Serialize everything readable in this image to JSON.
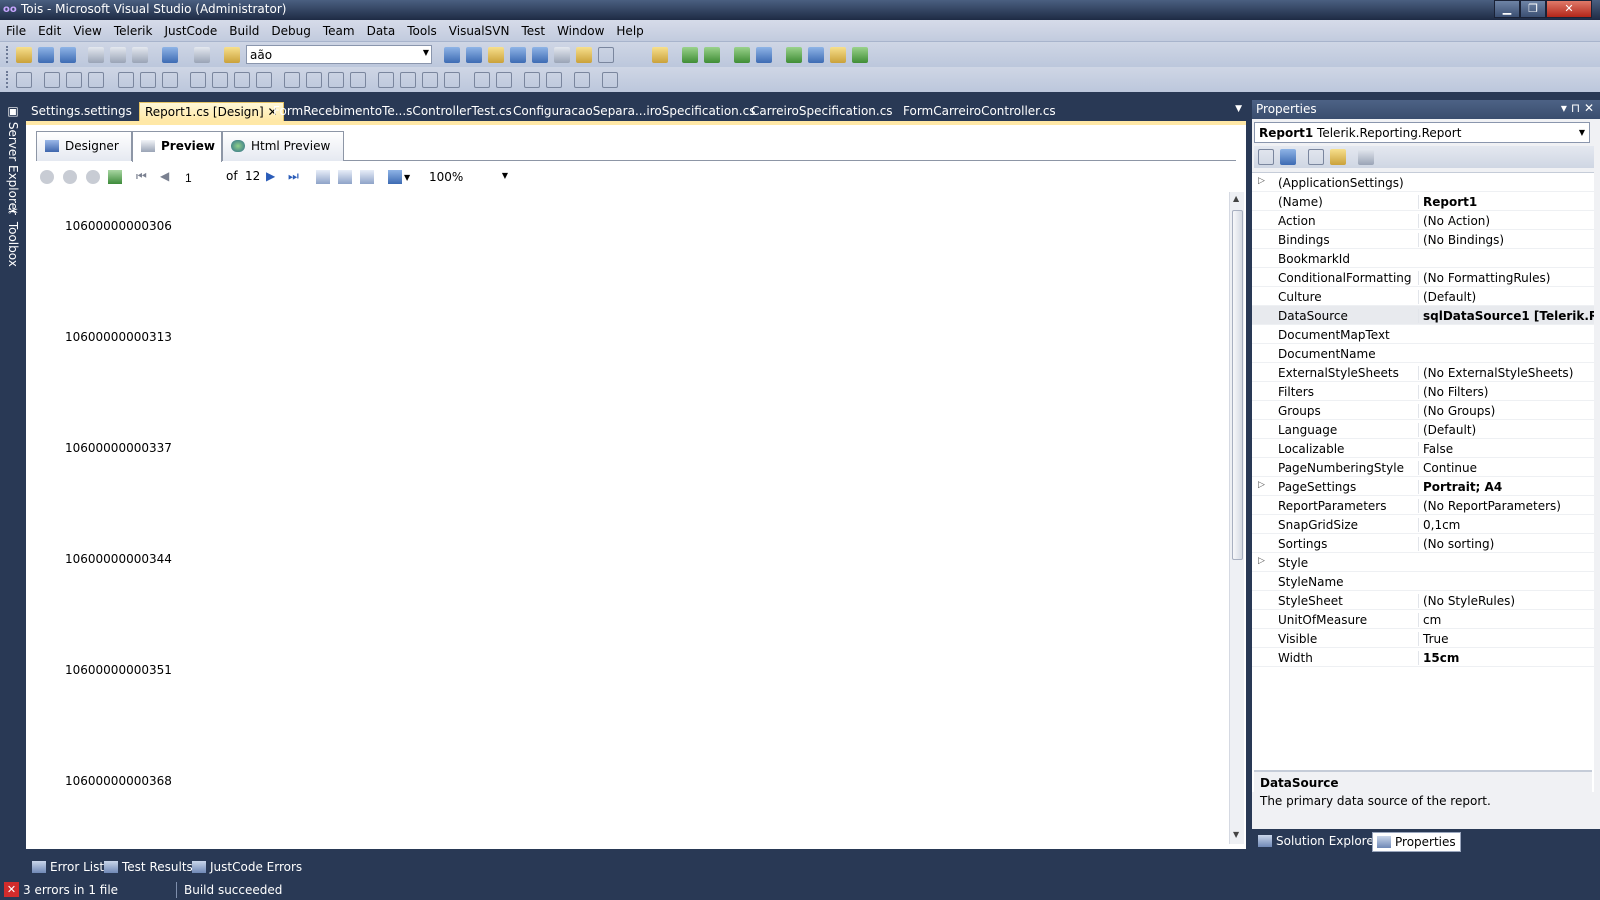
{
  "window": {
    "title": "Tois - Microsoft Visual Studio (Administrator)",
    "app_icon": "oo",
    "minimize_glyph": "▁",
    "restore_glyph": "❐",
    "close_glyph": "✕"
  },
  "menu": {
    "items": [
      "File",
      "Edit",
      "View",
      "Telerik",
      "JustCode",
      "Build",
      "Debug",
      "Team",
      "Data",
      "Tools",
      "VisualSVN",
      "Test",
      "Window",
      "Help"
    ]
  },
  "toolbar": {
    "search_value": "aão"
  },
  "left_rail": {
    "server_explorer": "Server Explorer",
    "toolbox": "Toolbox"
  },
  "doc_tabs": {
    "tabs": [
      {
        "label": "Settings.settings"
      },
      {
        "label": "Report1.cs [Design]"
      },
      {
        "label": "FormRecebimentoTe...sControllerTest.cs"
      },
      {
        "label": "ConfiguracaoSepara...iroSpecification.cs"
      },
      {
        "label": "CarreiroSpecification.cs"
      },
      {
        "label": "FormCarreiroController.cs"
      }
    ],
    "close_glyph": "✕",
    "dropdown_glyph": "▼"
  },
  "view_tabs": {
    "designer": "Designer",
    "preview": "Preview",
    "html_preview": "Html Preview"
  },
  "report_toolbar": {
    "page_value": "1",
    "of_label": "of",
    "total_pages": "12",
    "zoom": "100%"
  },
  "report_rows": [
    "10600000000306",
    "10600000000313",
    "10600000000337",
    "10600000000344",
    "10600000000351",
    "10600000000368"
  ],
  "properties": {
    "title": "Properties",
    "pin_glyphs": "▾ ⊓ ✕",
    "object_name": "Report1",
    "object_type": "Telerik.Reporting.Report",
    "rows": [
      {
        "name": "(ApplicationSettings)",
        "value": "",
        "expandable": true
      },
      {
        "name": "(Name)",
        "value": "Report1",
        "bold": true
      },
      {
        "name": "Action",
        "value": "(No Action)"
      },
      {
        "name": "Bindings",
        "value": "(No Bindings)"
      },
      {
        "name": "BookmarkId",
        "value": ""
      },
      {
        "name": "ConditionalFormatting",
        "value": "(No FormattingRules)"
      },
      {
        "name": "Culture",
        "value": "(Default)"
      },
      {
        "name": "DataSource",
        "value": "sqlDataSource1 [Telerik.Reporting.SqlDataSource]",
        "bold": true,
        "selected": true
      },
      {
        "name": "DocumentMapText",
        "value": ""
      },
      {
        "name": "DocumentName",
        "value": ""
      },
      {
        "name": "ExternalStyleSheets",
        "value": "(No ExternalStyleSheets)"
      },
      {
        "name": "Filters",
        "value": "(No Filters)"
      },
      {
        "name": "Groups",
        "value": "(No Groups)"
      },
      {
        "name": "Language",
        "value": "(Default)"
      },
      {
        "name": "Localizable",
        "value": "False"
      },
      {
        "name": "PageNumberingStyle",
        "value": "Continue"
      },
      {
        "name": "PageSettings",
        "value": "Portrait; A4",
        "bold": true,
        "expandable": true
      },
      {
        "name": "ReportParameters",
        "value": "(No ReportParameters)"
      },
      {
        "name": "SnapGridSize",
        "value": "0,1cm"
      },
      {
        "name": "Sortings",
        "value": "(No sorting)"
      },
      {
        "name": "Style",
        "value": "",
        "expandable": true
      },
      {
        "name": "StyleName",
        "value": ""
      },
      {
        "name": "StyleSheet",
        "value": "(No StyleRules)"
      },
      {
        "name": "UnitOfMeasure",
        "value": "cm"
      },
      {
        "name": "Visible",
        "value": "True"
      },
      {
        "name": "Width",
        "value": "15cm",
        "bold": true
      }
    ],
    "description_title": "DataSource",
    "description_text": "The primary data source of the report."
  },
  "right_bottom_tabs": {
    "solution_explorer": "Solution Explorer",
    "properties": "Properties"
  },
  "bottom_tabs": {
    "error_list": "Error List",
    "test_results": "Test Results",
    "justcode_errors": "JustCode Errors"
  },
  "status": {
    "errors": "3 errors in 1 file",
    "build": "Build succeeded"
  }
}
